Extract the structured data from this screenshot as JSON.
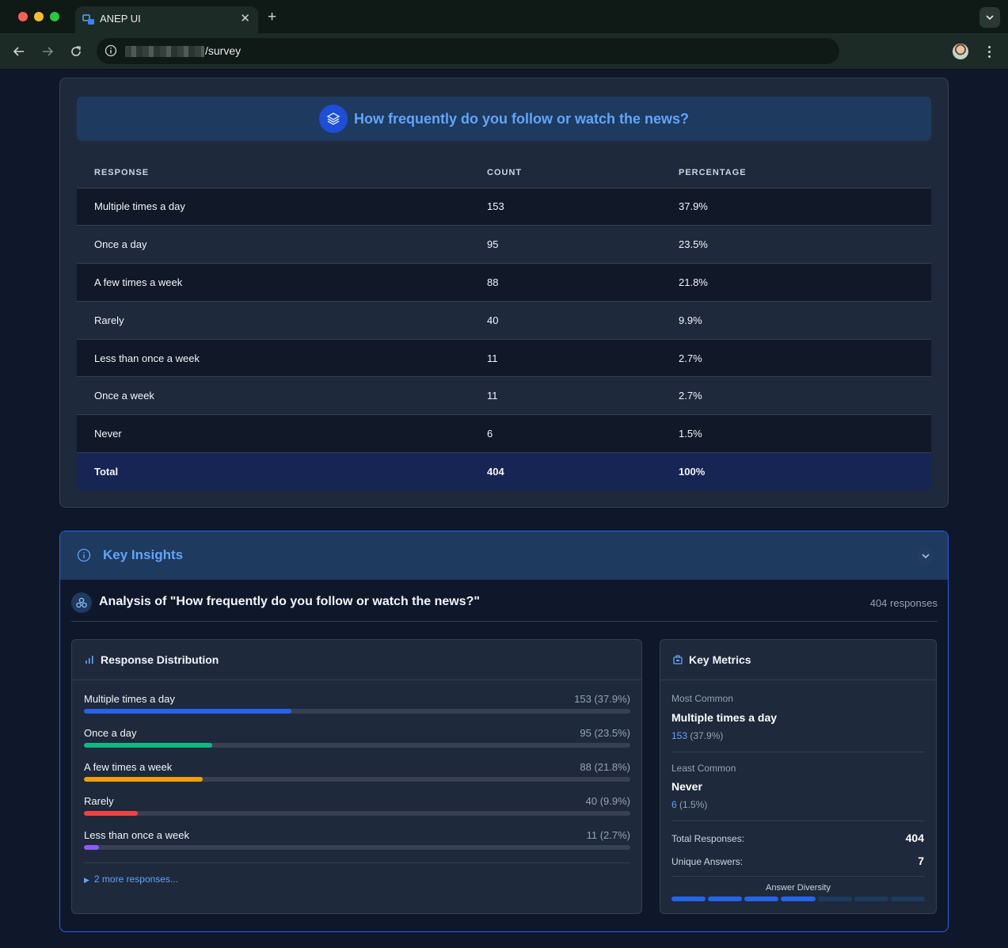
{
  "browser": {
    "tab_title": "ANEP UI",
    "url_path": "/survey"
  },
  "question": {
    "title": "How frequently do you follow or watch the news?"
  },
  "table": {
    "headers": [
      "RESPONSE",
      "COUNT",
      "PERCENTAGE"
    ],
    "rows": [
      {
        "response": "Multiple times a day",
        "count": "153",
        "percentage": "37.9%"
      },
      {
        "response": "Once a day",
        "count": "95",
        "percentage": "23.5%"
      },
      {
        "response": "A few times a week",
        "count": "88",
        "percentage": "21.8%"
      },
      {
        "response": "Rarely",
        "count": "40",
        "percentage": "9.9%"
      },
      {
        "response": "Less than once a week",
        "count": "11",
        "percentage": "2.7%"
      },
      {
        "response": "Once a week",
        "count": "11",
        "percentage": "2.7%"
      },
      {
        "response": "Never",
        "count": "6",
        "percentage": "1.5%"
      }
    ],
    "total": {
      "response": "Total",
      "count": "404",
      "percentage": "100%"
    }
  },
  "insights": {
    "title": "Key Insights",
    "analysis_title": "Analysis of \"How frequently do you follow or watch the news?\"",
    "response_count": "404 responses",
    "distribution": {
      "title": "Response Distribution",
      "items": [
        {
          "label": "Multiple times a day",
          "value": "153 (37.9%)",
          "fraction": 0.379,
          "color": "#2563eb"
        },
        {
          "label": "Once a day",
          "value": "95 (23.5%)",
          "fraction": 0.235,
          "color": "#10b981"
        },
        {
          "label": "A few times a week",
          "value": "88 (21.8%)",
          "fraction": 0.218,
          "color": "#f59e0b"
        },
        {
          "label": "Rarely",
          "value": "40 (9.9%)",
          "fraction": 0.099,
          "color": "#ef4444"
        },
        {
          "label": "Less than once a week",
          "value": "11 (2.7%)",
          "fraction": 0.027,
          "color": "#8b5cf6"
        }
      ],
      "more_label": "2 more responses..."
    },
    "metrics": {
      "title": "Key Metrics",
      "most_common_label": "Most Common",
      "most_common_value": "Multiple times a day",
      "most_common_count": "153",
      "most_common_pct": "(37.9%)",
      "least_common_label": "Least Common",
      "least_common_value": "Never",
      "least_common_count": "6",
      "least_common_pct": "(1.5%)",
      "total_label": "Total Responses:",
      "total_value": "404",
      "unique_label": "Unique Answers:",
      "unique_value": "7",
      "diversity_label": "Answer Diversity",
      "diversity_filled": 4,
      "diversity_total": 7
    }
  }
}
